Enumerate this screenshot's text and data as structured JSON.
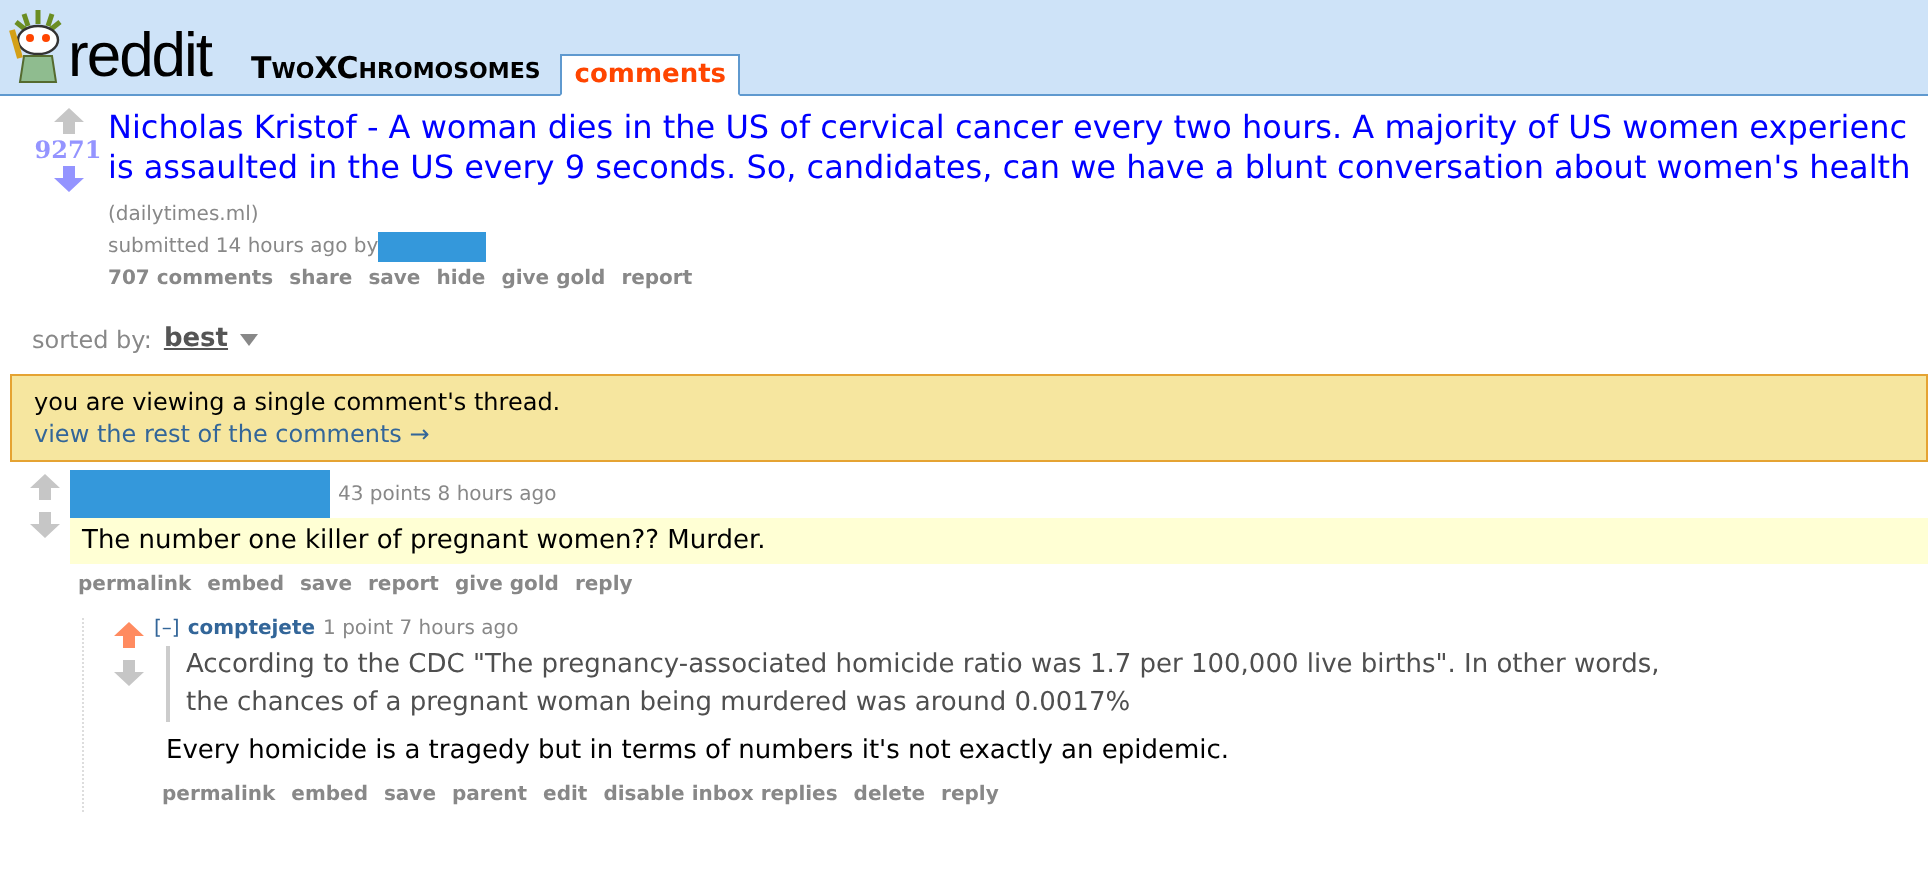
{
  "header": {
    "logo_text": "reddit",
    "subreddit": "TwoXChromosomes",
    "tabs": [
      {
        "label": "comments",
        "selected": true
      }
    ]
  },
  "post": {
    "upvoted": false,
    "downvoted": true,
    "score": "9271",
    "title_lines": [
      "Nicholas Kristof - A woman dies in the US of cervical cancer every two hours. A majority of US women experienc",
      "is assaulted in the US every 9 seconds. So, candidates, can we have a blunt conversation about women's health"
    ],
    "domain": "(dailytimes.ml)",
    "submitted": "submitted 14 hours ago by",
    "actions": [
      "707 comments",
      "share",
      "save",
      "hide",
      "give gold",
      "report"
    ]
  },
  "sort": {
    "label": "sorted by:",
    "value": "best"
  },
  "notice": {
    "text": "you are viewing a single comment's thread.",
    "link": "view the rest of the comments →"
  },
  "comments": [
    {
      "upvoted": false,
      "downvoted": false,
      "meta": "43 points 8 hours ago",
      "highlighted": true,
      "body": [
        "The number one killer of pregnant women?? Murder."
      ],
      "actions": [
        "permalink",
        "embed",
        "save",
        "report",
        "give gold",
        "reply"
      ],
      "children": [
        {
          "upvoted": true,
          "downvoted": false,
          "collapse": "[–]",
          "author": "comptejete",
          "meta": "1 point 7 hours ago",
          "highlighted": false,
          "quote": [
            "According to the CDC \"The pregnancy-associated homicide ratio was 1.7 per 100,000 live births\". In other words,",
            "the chances of a pregnant woman being murdered was around 0.0017%"
          ],
          "body": [
            "Every homicide is a tragedy but in terms of numbers it's not exactly an epidemic."
          ],
          "actions": [
            "permalink",
            "embed",
            "save",
            "parent",
            "edit",
            "disable inbox replies",
            "delete",
            "reply"
          ]
        }
      ]
    }
  ]
}
